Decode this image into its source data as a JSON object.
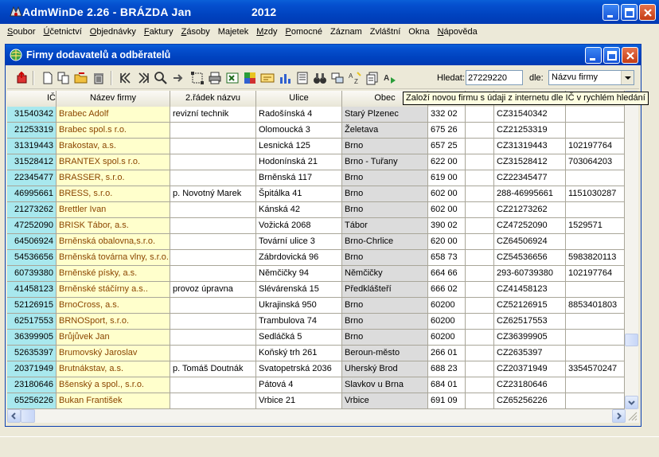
{
  "app": {
    "title": "AdmWinDe 2.26 - BRÁZDA Jan",
    "year": "2012"
  },
  "menu": [
    {
      "u": "S",
      "rest": "oubor"
    },
    {
      "u": "Ú",
      "rest": "četnictví"
    },
    {
      "u": "O",
      "rest": "bjednávky"
    },
    {
      "u": "F",
      "rest": "aktury"
    },
    {
      "u": "Z",
      "rest": "ásoby"
    },
    {
      "u": "",
      "rest": "Majetek"
    },
    {
      "u": "M",
      "rest": "zdy"
    },
    {
      "u": "P",
      "rest": "omocné"
    },
    {
      "u": "",
      "rest": "Záznam"
    },
    {
      "u": "",
      "rest": "Zvláštní"
    },
    {
      "u": "",
      "rest": "Okna"
    },
    {
      "u": "N",
      "rest": "ápověda"
    }
  ],
  "window": {
    "title": "Firmy dodavatelů a odběratelů"
  },
  "search": {
    "label": "Hledat:",
    "value": "27229220",
    "by_label": "dle:",
    "by_value": "Názvu firmy"
  },
  "tooltip": "Založí novou firmu s údaji z internetu dle IČ v rychlém hledání",
  "columns": [
    "IČ",
    "Název firmy",
    "2.řádek názvu",
    "Ulice",
    "Obec",
    "",
    "",
    "",
    ""
  ],
  "rows": [
    [
      "31540342",
      "Brabec Adolf",
      "revizní technik",
      "Radošínská 4",
      "Starý Plzenec",
      "332 02",
      "",
      "CZ31540342",
      ""
    ],
    [
      "21253319",
      "Brabec spol.s r.o.",
      "",
      "Olomoucká 3",
      "Želetava",
      "675 26",
      "",
      "CZ21253319",
      ""
    ],
    [
      "31319443",
      "Brakostav, a.s.",
      "",
      "Lesnická 125",
      "Brno",
      "657 25",
      "",
      "CZ31319443",
      "102197764"
    ],
    [
      "31528412",
      "BRANTEX  spol.s r.o.",
      "",
      "Hodonínská 21",
      "Brno - Tuřany",
      "622 00",
      "",
      "CZ31528412",
      "703064203"
    ],
    [
      "22345477",
      "BRASSER, s.r.o.",
      "",
      "Brněnská 117",
      "Brno",
      "619 00",
      "",
      "CZ22345477",
      ""
    ],
    [
      "46995661",
      "BRESS, s.r.o.",
      "p. Novotný Marek",
      "Špitálka 41",
      "Brno",
      "602 00",
      "",
      "288-46995661",
      "1151030287"
    ],
    [
      "21273262",
      "Brettler Ivan",
      "",
      "Kánská 42",
      "Brno",
      "602 00",
      "",
      "CZ21273262",
      ""
    ],
    [
      "47252090",
      "BRISK Tábor, a.s.",
      "",
      "Vožická 2068",
      "Tábor",
      "390 02",
      "",
      "CZ47252090",
      "1529571"
    ],
    [
      "64506924",
      "Brněnská obalovna,s.r.o.",
      "",
      "Tovární ulice 3",
      "Brno-Chrlice",
      "620 00",
      "",
      "CZ64506924",
      ""
    ],
    [
      "54536656",
      "Brněnská továrna vlny, s.r.o.",
      "",
      "Zábrdovická 96",
      "Brno",
      "658 73",
      "",
      "CZ54536656",
      "5983820113"
    ],
    [
      "60739380",
      "Brněnské písky, a.s.",
      "",
      "Němčičky 94",
      "Němčičky",
      "664 66",
      "",
      "293-60739380",
      "102197764"
    ],
    [
      "41458123",
      "Brněnské stáčírny a.s..",
      "provoz úpravna",
      "Slévárenská 15",
      "Předklášteří",
      "666 02",
      "",
      "CZ41458123",
      ""
    ],
    [
      "52126915",
      "BrnoCross, a.s.",
      "",
      "Ukrajinská 950",
      "Brno",
      "60200",
      "",
      "CZ52126915",
      "8853401803"
    ],
    [
      "62517553",
      "BRNOSport, s.r.o.",
      "",
      "Trambulova 74",
      "Brno",
      "60200",
      "",
      "CZ62517553",
      ""
    ],
    [
      "36399905",
      "Brůjůvek Jan",
      "",
      "Sedláčká 5",
      "Brno",
      "60200",
      "",
      "CZ36399905",
      ""
    ],
    [
      "52635397",
      "Brumovský Jaroslav",
      "",
      "Koňský trh 261",
      "Beroun-město",
      "266 01",
      "",
      "CZ2635397",
      ""
    ],
    [
      "20371949",
      "Brutnákstav, a.s.",
      "p. Tomáš Doutnák",
      "Svatopetrská 2036",
      "Uherský Brod",
      "688 23",
      "",
      "CZ20371949",
      "3354570247"
    ],
    [
      "23180646",
      "Bšenský a spol., s.r.o.",
      "",
      "Pátová 4",
      "Slavkov u Brna",
      "684 01",
      "",
      "CZ23180646",
      ""
    ],
    [
      "65256226",
      "Bukan František",
      "",
      "Vrbice 21",
      "Vrbice",
      "691 09",
      "",
      "CZ65256226",
      ""
    ]
  ]
}
